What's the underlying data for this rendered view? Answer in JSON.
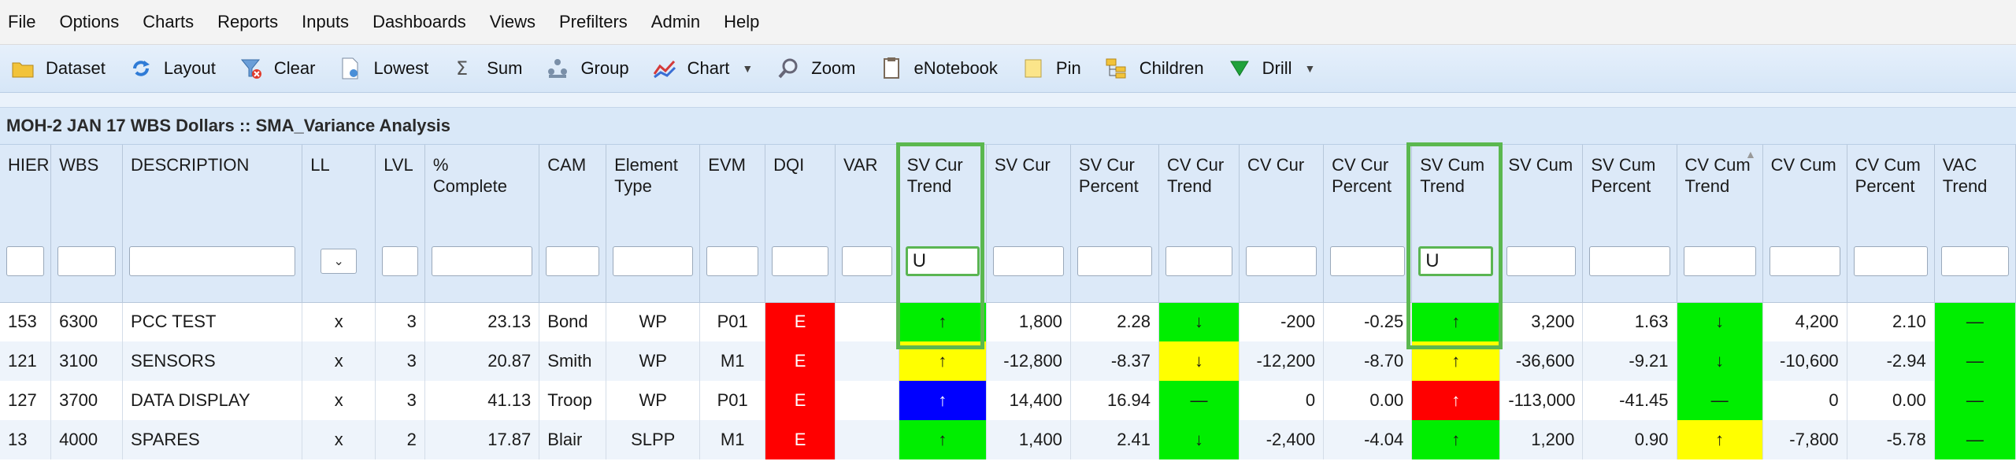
{
  "menu": [
    "File",
    "Options",
    "Charts",
    "Reports",
    "Inputs",
    "Dashboards",
    "Views",
    "Prefilters",
    "Admin",
    "Help"
  ],
  "toolbar": [
    {
      "label": "Dataset",
      "icon": "folder-icon",
      "caret": false
    },
    {
      "label": "Layout",
      "icon": "refresh-icon",
      "caret": false
    },
    {
      "label": "Clear",
      "icon": "funnel-clear-icon",
      "caret": false
    },
    {
      "label": "Lowest",
      "icon": "document-icon",
      "caret": false
    },
    {
      "label": "Sum",
      "icon": "sigma-icon",
      "caret": false
    },
    {
      "label": "Group",
      "icon": "group-icon",
      "caret": false
    },
    {
      "label": "Chart",
      "icon": "line-chart-icon",
      "caret": true
    },
    {
      "label": "Zoom",
      "icon": "magnifier-icon",
      "caret": false
    },
    {
      "label": "eNotebook",
      "icon": "notebook-icon",
      "caret": false
    },
    {
      "label": "Pin",
      "icon": "note-icon",
      "caret": false
    },
    {
      "label": "Children",
      "icon": "hierarchy-icon",
      "caret": false
    },
    {
      "label": "Drill",
      "icon": "drill-down-icon",
      "caret": true
    }
  ],
  "title": "MOH-2 JAN 17 WBS Dollars :: SMA_Variance Analysis",
  "columns": [
    {
      "l1": "HIER",
      "l2": ""
    },
    {
      "l1": "WBS",
      "l2": ""
    },
    {
      "l1": "DESCRIPTION",
      "l2": ""
    },
    {
      "l1": "LL",
      "l2": ""
    },
    {
      "l1": "LVL",
      "l2": ""
    },
    {
      "l1": "%",
      "l2": "Complete"
    },
    {
      "l1": "CAM",
      "l2": ""
    },
    {
      "l1": "Element",
      "l2": "Type"
    },
    {
      "l1": "EVM",
      "l2": ""
    },
    {
      "l1": "DQI",
      "l2": ""
    },
    {
      "l1": "VAR",
      "l2": ""
    },
    {
      "l1": "SV Cur",
      "l2": "Trend"
    },
    {
      "l1": "SV Cur",
      "l2": ""
    },
    {
      "l1": "SV Cur",
      "l2": "Percent"
    },
    {
      "l1": "CV Cur",
      "l2": "Trend"
    },
    {
      "l1": "CV Cur",
      "l2": ""
    },
    {
      "l1": "CV Cur",
      "l2": "Percent"
    },
    {
      "l1": "SV Cum",
      "l2": "Trend"
    },
    {
      "l1": "SV Cum",
      "l2": ""
    },
    {
      "l1": "SV Cum",
      "l2": "Percent"
    },
    {
      "l1": "CV Cum",
      "l2": "Trend"
    },
    {
      "l1": "CV Cum",
      "l2": ""
    },
    {
      "l1": "CV Cum",
      "l2": "Percent"
    },
    {
      "l1": "VAC",
      "l2": "Trend"
    }
  ],
  "filters": {
    "sv_cur_trend": "U",
    "sv_cum_trend": "U"
  },
  "rows": [
    {
      "hier": "153",
      "wbs": "6300",
      "desc": "PCC TEST",
      "ll": "x",
      "lvl": "3",
      "pct": "23.13",
      "cam": "Bond",
      "etype": "WP",
      "evm": "P01",
      "dqi": "E",
      "var": "",
      "sv_cur_trend": "↑",
      "sv_cur": "1,800",
      "sv_cur_pct": "2.28",
      "cv_cur_trend": "↓",
      "cv_cur": "-200",
      "cv_cur_pct": "-0.25",
      "sv_cum_trend": "↑",
      "sv_cum": "3,200",
      "sv_cum_pct": "1.63",
      "cv_cum_trend": "↓",
      "cv_cum": "4,200",
      "cv_cum_pct": "2.10",
      "vac_trend": "—",
      "colors": {
        "sv_cur_trend": "green",
        "cv_cur_trend": "green",
        "sv_cum_trend": "green",
        "cv_cum_trend": "green",
        "vac_trend": "green"
      }
    },
    {
      "hier": "121",
      "wbs": "3100",
      "desc": "SENSORS",
      "ll": "x",
      "lvl": "3",
      "pct": "20.87",
      "cam": "Smith",
      "etype": "WP",
      "evm": "M1",
      "dqi": "E",
      "var": "",
      "sv_cur_trend": "↑",
      "sv_cur": "-12,800",
      "sv_cur_pct": "-8.37",
      "cv_cur_trend": "↓",
      "cv_cur": "-12,200",
      "cv_cur_pct": "-8.70",
      "sv_cum_trend": "↑",
      "sv_cum": "-36,600",
      "sv_cum_pct": "-9.21",
      "cv_cum_trend": "↓",
      "cv_cum": "-10,600",
      "cv_cum_pct": "-2.94",
      "vac_trend": "—",
      "colors": {
        "sv_cur_trend": "yellow",
        "cv_cur_trend": "yellow",
        "sv_cum_trend": "yellow",
        "cv_cum_trend": "green",
        "vac_trend": "green"
      }
    },
    {
      "hier": "127",
      "wbs": "3700",
      "desc": "DATA DISPLAY",
      "ll": "x",
      "lvl": "3",
      "pct": "41.13",
      "cam": "Troop",
      "etype": "WP",
      "evm": "P01",
      "dqi": "E",
      "var": "",
      "sv_cur_trend": "↑",
      "sv_cur": "14,400",
      "sv_cur_pct": "16.94",
      "cv_cur_trend": "—",
      "cv_cur": "0",
      "cv_cur_pct": "0.00",
      "sv_cum_trend": "↑",
      "sv_cum": "-113,000",
      "sv_cum_pct": "-41.45",
      "cv_cum_trend": "—",
      "cv_cum": "0",
      "cv_cum_pct": "0.00",
      "vac_trend": "—",
      "colors": {
        "sv_cur_trend": "blue",
        "cv_cur_trend": "green",
        "sv_cum_trend": "sred",
        "cv_cum_trend": "green",
        "vac_trend": "green"
      }
    },
    {
      "hier": "13",
      "wbs": "4000",
      "desc": "SPARES",
      "ll": "x",
      "lvl": "2",
      "pct": "17.87",
      "cam": "Blair",
      "etype": "SLPP",
      "evm": "M1",
      "dqi": "E",
      "var": "",
      "sv_cur_trend": "↑",
      "sv_cur": "1,400",
      "sv_cur_pct": "2.41",
      "cv_cur_trend": "↓",
      "cv_cur": "-2,400",
      "cv_cur_pct": "-4.04",
      "sv_cum_trend": "↑",
      "sv_cum": "1,200",
      "sv_cum_pct": "0.90",
      "cv_cum_trend": "↑",
      "cv_cum": "-7,800",
      "cv_cum_pct": "-5.78",
      "vac_trend": "—",
      "colors": {
        "sv_cur_trend": "green",
        "cv_cur_trend": "green",
        "sv_cum_trend": "green",
        "cv_cum_trend": "yellow",
        "vac_trend": "green"
      }
    }
  ]
}
